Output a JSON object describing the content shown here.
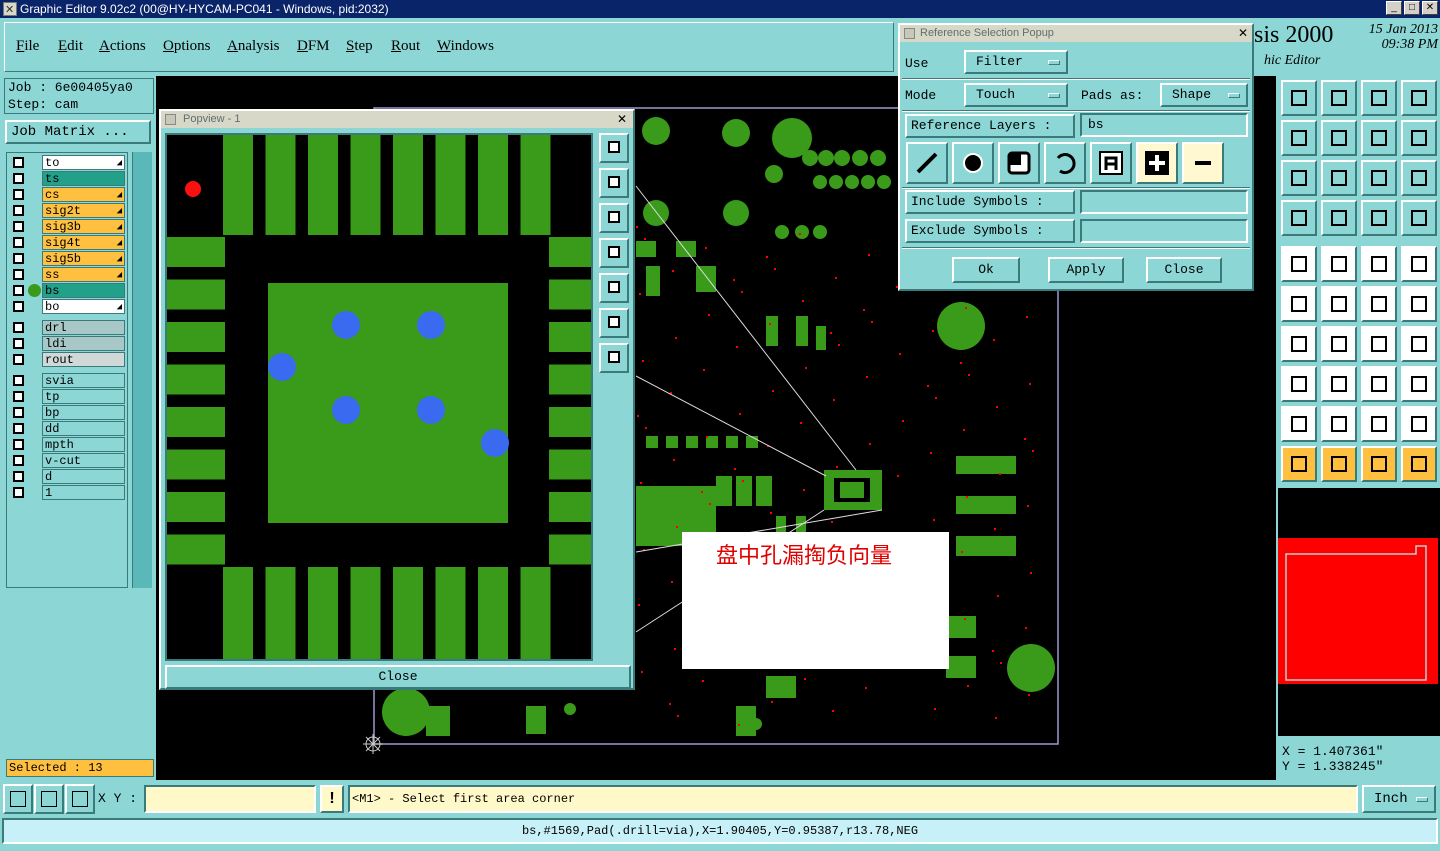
{
  "window": {
    "title": "Graphic Editor 9.02c2 (00@HY-HYCAM-PC041 - Windows, pid:2032)",
    "buttons": [
      "_",
      "□",
      "✕"
    ]
  },
  "menubar": [
    "File",
    "Edit",
    "Actions",
    "Options",
    "Analysis",
    "DFM",
    "Step",
    "Rout",
    "Windows"
  ],
  "brand": {
    "name": "sis 2000",
    "subtitle": "hic Editor"
  },
  "datetime": {
    "date": "15 Jan 2013",
    "time": "09:38 PM"
  },
  "job": {
    "job_line": "Job : 6e00405ya0",
    "step_line": "Step: cam",
    "matrix_button": "Job Matrix ..."
  },
  "layers": [
    {
      "name": "to",
      "color": "#ffffff",
      "arrow": true
    },
    {
      "name": "ts",
      "color": "#22a08a",
      "arrow": false
    },
    {
      "name": "cs",
      "color": "#ffc040",
      "arrow": true
    },
    {
      "name": "sig2t",
      "color": "#ffc040",
      "arrow": true
    },
    {
      "name": "sig3b",
      "color": "#ffc040",
      "arrow": true
    },
    {
      "name": "sig4t",
      "color": "#ffc040",
      "arrow": true
    },
    {
      "name": "sig5b",
      "color": "#ffc040",
      "arrow": true
    },
    {
      "name": "ss",
      "color": "#ffc040",
      "arrow": true
    },
    {
      "name": "bs",
      "color": "#22a08a",
      "arrow": false,
      "active": true
    },
    {
      "name": "bo",
      "color": "#ffffff",
      "arrow": true
    },
    {
      "name": "drl",
      "color": "#a8c8c8",
      "arrow": false
    },
    {
      "name": "ldi",
      "color": "#a8c8c8",
      "arrow": false
    },
    {
      "name": "rout",
      "color": "#d0d8d8",
      "arrow": false
    },
    {
      "name": "svia",
      "color": "#8cd6d6",
      "arrow": false
    },
    {
      "name": "tp",
      "color": "#8cd6d6",
      "arrow": false
    },
    {
      "name": "bp",
      "color": "#8cd6d6",
      "arrow": false
    },
    {
      "name": "dd",
      "color": "#8cd6d6",
      "arrow": false
    },
    {
      "name": "mpth",
      "color": "#8cd6d6",
      "arrow": false
    },
    {
      "name": "v-cut",
      "color": "#8cd6d6",
      "arrow": false
    },
    {
      "name": "d",
      "color": "#8cd6d6",
      "arrow": false
    },
    {
      "name": "1",
      "color": "#8cd6d6",
      "arrow": false
    }
  ],
  "selected": "Selected : 13",
  "popview": {
    "title": "Popview - 1",
    "close_label": "Close"
  },
  "refpopup": {
    "title": "Reference Selection Popup",
    "use_label": "Use",
    "use_value": "Filter",
    "mode_label": "Mode",
    "mode_value": "Touch",
    "pads_label": "Pads as:",
    "pads_value": "Shape",
    "ref_layers_label": "Reference Layers :",
    "ref_layers_value": "bs",
    "include_label": "Include Symbols :",
    "include_value": "",
    "exclude_label": "Exclude Symbols :",
    "exclude_value": "",
    "ok_label": "Ok",
    "apply_label": "Apply",
    "close_label": "Close"
  },
  "annotation": "盘中孔漏掏负向量",
  "coords": {
    "x": "X = 1.407361\"",
    "y": "Y = 1.338245\""
  },
  "bottom": {
    "xy_label": "X Y :",
    "xy_value": "",
    "warn": "!",
    "message": "<M1> - Select first area corner",
    "units": "Inch"
  },
  "status": "bs,#1569,Pad(.drill=via),X=1.90405,Y=0.95387,r13.78,NEG",
  "colors": {
    "pcb_green": "#3a9a1a",
    "pad_blue": "#3a6af0",
    "highlight_red": "#ff0000",
    "ui_cyan": "#8cd6d6"
  }
}
